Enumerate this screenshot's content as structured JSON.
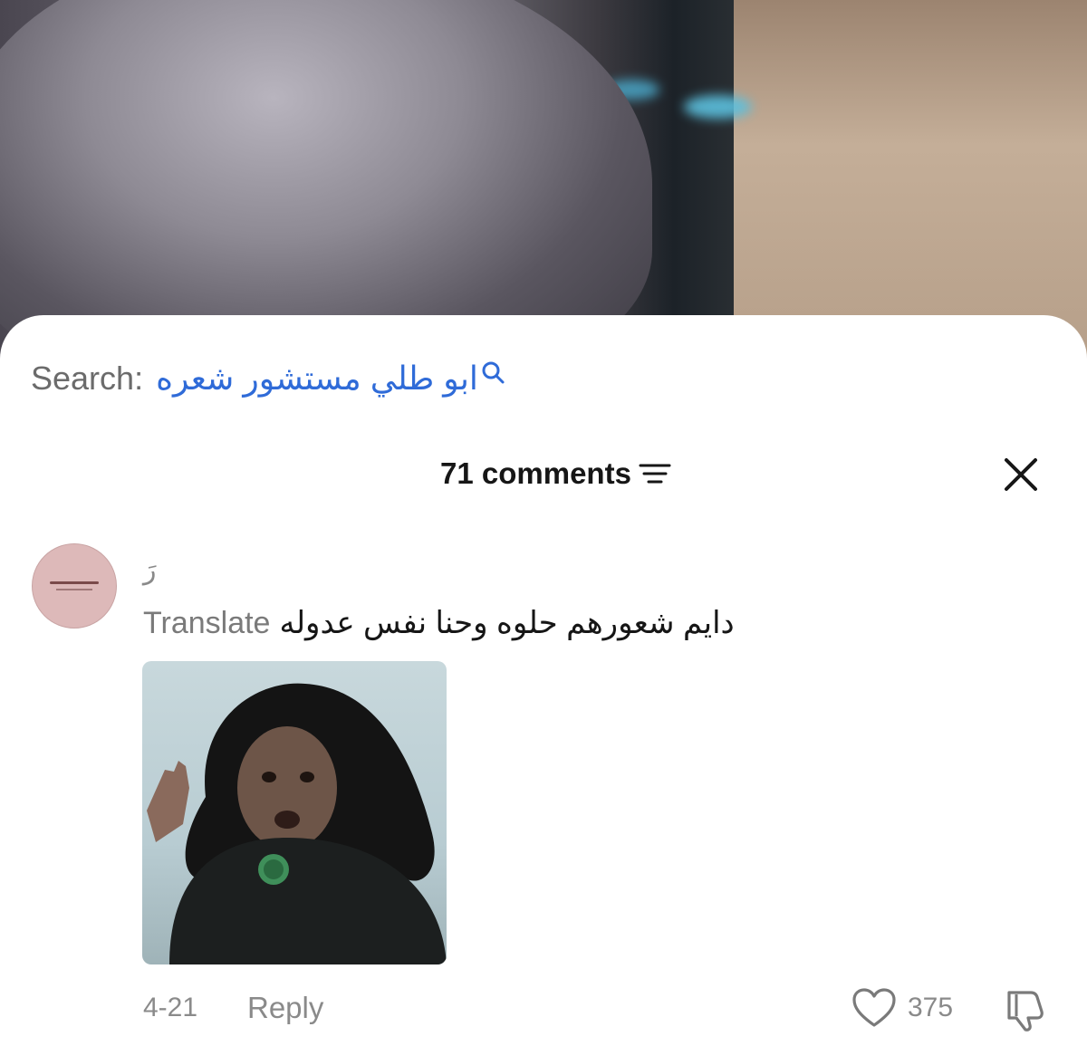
{
  "search": {
    "label": "Search:",
    "term": "ابو طلي مستشور شعره"
  },
  "comments_header": {
    "count_label": "71 comments"
  },
  "comment": {
    "username": "رَ",
    "translate_label": "Translate",
    "text": "دايم شعورهم حلوه وحنا نفس عدوله",
    "date": "4-21",
    "reply_label": "Reply",
    "like_count": "375"
  },
  "colors": {
    "search_term": "#2f6bd8",
    "muted_text": "#8a8a8a",
    "avatar_bg": "#ddb9b9"
  },
  "icons": {
    "search": "search-icon",
    "filter": "filter-icon",
    "close": "close-icon",
    "like": "heart-icon",
    "dislike": "dislike-icon"
  }
}
